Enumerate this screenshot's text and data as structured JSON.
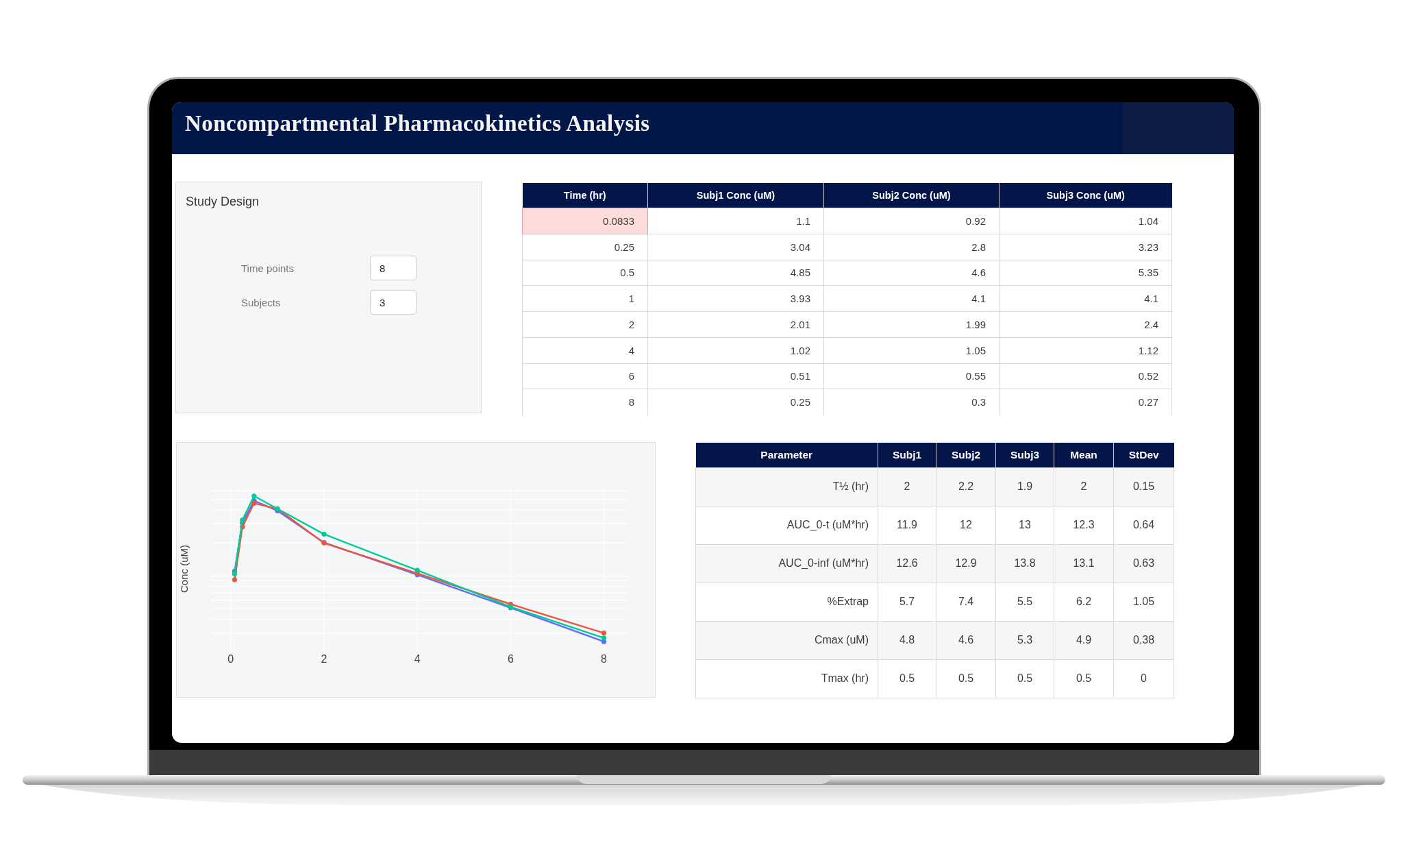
{
  "header": {
    "title": "Noncompartmental Pharmacokinetics Analysis"
  },
  "study_design": {
    "title": "Study Design",
    "fields": [
      {
        "label": "Time points",
        "value": "8"
      },
      {
        "label": "Subjects",
        "value": "3"
      }
    ]
  },
  "concentration_table": {
    "columns": [
      "Time (hr)",
      "Subj1 Conc (uM)",
      "Subj2 Conc (uM)",
      "Subj3 Conc (uM)"
    ],
    "rows": [
      {
        "cells": [
          {
            "text": "0.0833",
            "selected": true
          },
          {
            "text": "1.1",
            "selected": false
          },
          {
            "text": "0.92",
            "selected": false
          },
          {
            "text": "1.04",
            "selected": false
          }
        ]
      },
      {
        "cells": [
          {
            "text": "0.25",
            "selected": false
          },
          {
            "text": "3.04",
            "selected": false
          },
          {
            "text": "2.8",
            "selected": false
          },
          {
            "text": "3.23",
            "selected": false
          }
        ]
      },
      {
        "cells": [
          {
            "text": "0.5",
            "selected": false
          },
          {
            "text": "4.85",
            "selected": false
          },
          {
            "text": "4.6",
            "selected": false
          },
          {
            "text": "5.35",
            "selected": false
          }
        ]
      },
      {
        "cells": [
          {
            "text": "1",
            "selected": false
          },
          {
            "text": "3.93",
            "selected": false
          },
          {
            "text": "4.1",
            "selected": false
          },
          {
            "text": "4.1",
            "selected": false
          }
        ]
      },
      {
        "cells": [
          {
            "text": "2",
            "selected": false
          },
          {
            "text": "2.01",
            "selected": false
          },
          {
            "text": "1.99",
            "selected": false
          },
          {
            "text": "2.4",
            "selected": false
          }
        ]
      },
      {
        "cells": [
          {
            "text": "4",
            "selected": false
          },
          {
            "text": "1.02",
            "selected": false
          },
          {
            "text": "1.05",
            "selected": false
          },
          {
            "text": "1.12",
            "selected": false
          }
        ]
      },
      {
        "cells": [
          {
            "text": "6",
            "selected": false
          },
          {
            "text": "0.51",
            "selected": false
          },
          {
            "text": "0.55",
            "selected": false
          },
          {
            "text": "0.52",
            "selected": false
          }
        ]
      },
      {
        "cells": [
          {
            "text": "8",
            "selected": false
          },
          {
            "text": "0.25",
            "selected": false
          },
          {
            "text": "0.3",
            "selected": false
          },
          {
            "text": "0.27",
            "selected": false
          }
        ]
      }
    ]
  },
  "concentration_chart": {
    "y_axis_label": "Conc (uM)",
    "x_tick_labels": [
      "0",
      "2",
      "4",
      "6",
      "8"
    ]
  },
  "parameters_table": {
    "columns": [
      "Parameter",
      "Subj1",
      "Subj2",
      "Subj3",
      "Mean",
      "StDev"
    ],
    "rows": [
      [
        "T½ (hr)",
        "2",
        "2.2",
        "1.9",
        "2",
        "0.15"
      ],
      [
        "AUC_0-t (uM*hr)",
        "11.9",
        "12",
        "13",
        "12.3",
        "0.64"
      ],
      [
        "AUC_0-inf (uM*hr)",
        "12.6",
        "12.9",
        "13.8",
        "13.1",
        "0.63"
      ],
      [
        "%Extrap",
        "5.7",
        "7.4",
        "5.5",
        "6.2",
        "1.05"
      ],
      [
        "Cmax (uM)",
        "4.8",
        "4.6",
        "5.3",
        "4.9",
        "0.38"
      ],
      [
        "Tmax (hr)",
        "0.5",
        "0.5",
        "0.5",
        "0.5",
        "0"
      ]
    ]
  }
}
